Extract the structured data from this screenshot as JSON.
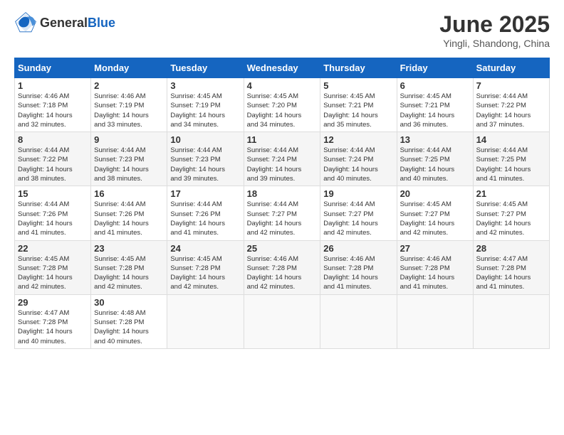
{
  "header": {
    "logo_general": "General",
    "logo_blue": "Blue",
    "title": "June 2025",
    "location": "Yingli, Shandong, China"
  },
  "calendar": {
    "days_of_week": [
      "Sunday",
      "Monday",
      "Tuesday",
      "Wednesday",
      "Thursday",
      "Friday",
      "Saturday"
    ],
    "weeks": [
      [
        {
          "day": "",
          "info": ""
        },
        {
          "day": "2",
          "info": "Sunrise: 4:46 AM\nSunset: 7:19 PM\nDaylight: 14 hours\nand 33 minutes."
        },
        {
          "day": "3",
          "info": "Sunrise: 4:45 AM\nSunset: 7:19 PM\nDaylight: 14 hours\nand 34 minutes."
        },
        {
          "day": "4",
          "info": "Sunrise: 4:45 AM\nSunset: 7:20 PM\nDaylight: 14 hours\nand 34 minutes."
        },
        {
          "day": "5",
          "info": "Sunrise: 4:45 AM\nSunset: 7:21 PM\nDaylight: 14 hours\nand 35 minutes."
        },
        {
          "day": "6",
          "info": "Sunrise: 4:45 AM\nSunset: 7:21 PM\nDaylight: 14 hours\nand 36 minutes."
        },
        {
          "day": "7",
          "info": "Sunrise: 4:44 AM\nSunset: 7:22 PM\nDaylight: 14 hours\nand 37 minutes."
        }
      ],
      [
        {
          "day": "8",
          "info": "Sunrise: 4:44 AM\nSunset: 7:22 PM\nDaylight: 14 hours\nand 38 minutes."
        },
        {
          "day": "9",
          "info": "Sunrise: 4:44 AM\nSunset: 7:23 PM\nDaylight: 14 hours\nand 38 minutes."
        },
        {
          "day": "10",
          "info": "Sunrise: 4:44 AM\nSunset: 7:23 PM\nDaylight: 14 hours\nand 39 minutes."
        },
        {
          "day": "11",
          "info": "Sunrise: 4:44 AM\nSunset: 7:24 PM\nDaylight: 14 hours\nand 39 minutes."
        },
        {
          "day": "12",
          "info": "Sunrise: 4:44 AM\nSunset: 7:24 PM\nDaylight: 14 hours\nand 40 minutes."
        },
        {
          "day": "13",
          "info": "Sunrise: 4:44 AM\nSunset: 7:25 PM\nDaylight: 14 hours\nand 40 minutes."
        },
        {
          "day": "14",
          "info": "Sunrise: 4:44 AM\nSunset: 7:25 PM\nDaylight: 14 hours\nand 41 minutes."
        }
      ],
      [
        {
          "day": "15",
          "info": "Sunrise: 4:44 AM\nSunset: 7:26 PM\nDaylight: 14 hours\nand 41 minutes."
        },
        {
          "day": "16",
          "info": "Sunrise: 4:44 AM\nSunset: 7:26 PM\nDaylight: 14 hours\nand 41 minutes."
        },
        {
          "day": "17",
          "info": "Sunrise: 4:44 AM\nSunset: 7:26 PM\nDaylight: 14 hours\nand 41 minutes."
        },
        {
          "day": "18",
          "info": "Sunrise: 4:44 AM\nSunset: 7:27 PM\nDaylight: 14 hours\nand 42 minutes."
        },
        {
          "day": "19",
          "info": "Sunrise: 4:44 AM\nSunset: 7:27 PM\nDaylight: 14 hours\nand 42 minutes."
        },
        {
          "day": "20",
          "info": "Sunrise: 4:45 AM\nSunset: 7:27 PM\nDaylight: 14 hours\nand 42 minutes."
        },
        {
          "day": "21",
          "info": "Sunrise: 4:45 AM\nSunset: 7:27 PM\nDaylight: 14 hours\nand 42 minutes."
        }
      ],
      [
        {
          "day": "22",
          "info": "Sunrise: 4:45 AM\nSunset: 7:28 PM\nDaylight: 14 hours\nand 42 minutes."
        },
        {
          "day": "23",
          "info": "Sunrise: 4:45 AM\nSunset: 7:28 PM\nDaylight: 14 hours\nand 42 minutes."
        },
        {
          "day": "24",
          "info": "Sunrise: 4:45 AM\nSunset: 7:28 PM\nDaylight: 14 hours\nand 42 minutes."
        },
        {
          "day": "25",
          "info": "Sunrise: 4:46 AM\nSunset: 7:28 PM\nDaylight: 14 hours\nand 42 minutes."
        },
        {
          "day": "26",
          "info": "Sunrise: 4:46 AM\nSunset: 7:28 PM\nDaylight: 14 hours\nand 41 minutes."
        },
        {
          "day": "27",
          "info": "Sunrise: 4:46 AM\nSunset: 7:28 PM\nDaylight: 14 hours\nand 41 minutes."
        },
        {
          "day": "28",
          "info": "Sunrise: 4:47 AM\nSunset: 7:28 PM\nDaylight: 14 hours\nand 41 minutes."
        }
      ],
      [
        {
          "day": "29",
          "info": "Sunrise: 4:47 AM\nSunset: 7:28 PM\nDaylight: 14 hours\nand 40 minutes."
        },
        {
          "day": "30",
          "info": "Sunrise: 4:48 AM\nSunset: 7:28 PM\nDaylight: 14 hours\nand 40 minutes."
        },
        {
          "day": "",
          "info": ""
        },
        {
          "day": "",
          "info": ""
        },
        {
          "day": "",
          "info": ""
        },
        {
          "day": "",
          "info": ""
        },
        {
          "day": "",
          "info": ""
        }
      ]
    ],
    "first_week_sunday": {
      "day": "1",
      "info": "Sunrise: 4:46 AM\nSunset: 7:18 PM\nDaylight: 14 hours\nand 32 minutes."
    }
  }
}
